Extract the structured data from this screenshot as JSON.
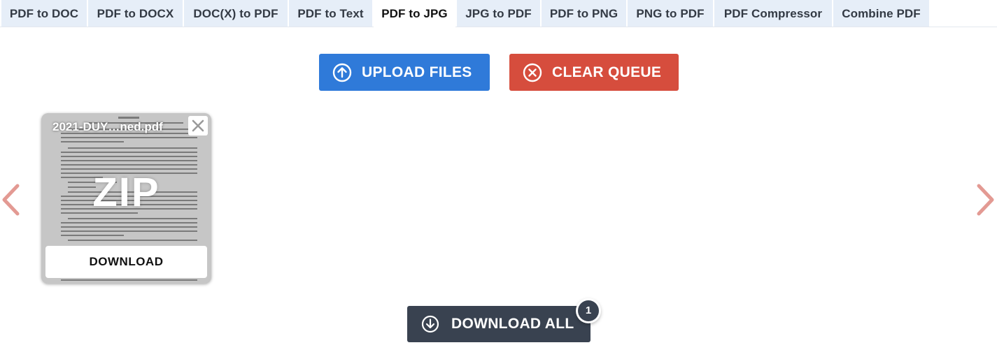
{
  "tabs": [
    {
      "label": "PDF to DOC",
      "active": false
    },
    {
      "label": "PDF to DOCX",
      "active": false
    },
    {
      "label": "DOC(X) to PDF",
      "active": false
    },
    {
      "label": "PDF to Text",
      "active": false
    },
    {
      "label": "PDF to JPG",
      "active": true
    },
    {
      "label": "JPG to PDF",
      "active": false
    },
    {
      "label": "PDF to PNG",
      "active": false
    },
    {
      "label": "PNG to PDF",
      "active": false
    },
    {
      "label": "PDF Compressor",
      "active": false
    },
    {
      "label": "Combine PDF",
      "active": false
    }
  ],
  "toolbar": {
    "upload_label": "UPLOAD FILES",
    "upload_icon": "arrow-up-circle-icon",
    "clear_label": "CLEAR QUEUE",
    "clear_icon": "x-circle-icon"
  },
  "colors": {
    "upload": "#2f7ad9",
    "clear": "#d64d3d",
    "download_all": "#394250",
    "tab_bg": "#e6eef8",
    "arrow": "#e39a93"
  },
  "queue": {
    "items": [
      {
        "filename": "2021-DUY…ned.pdf",
        "format_label": "ZIP",
        "download_label": "DOWNLOAD"
      }
    ]
  },
  "footer": {
    "download_all_label": "DOWNLOAD ALL",
    "count": "1"
  }
}
